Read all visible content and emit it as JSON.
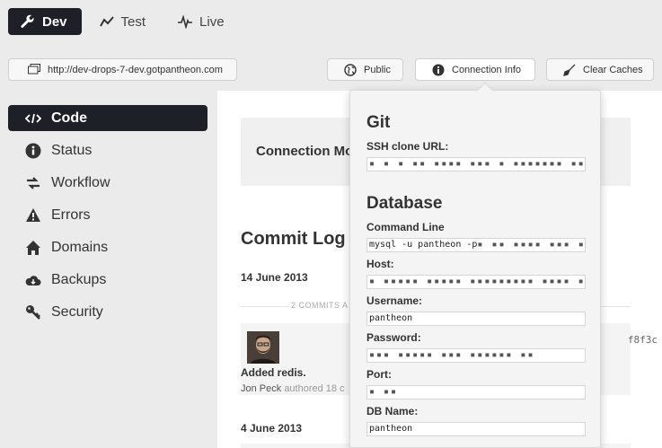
{
  "env_tabs": [
    {
      "label": "Dev",
      "icon": "wrench-icon",
      "active": true
    },
    {
      "label": "Test",
      "icon": "trend-icon",
      "active": false
    },
    {
      "label": "Live",
      "icon": "pulse-icon",
      "active": false
    }
  ],
  "url": "http://dev-drops-7-dev.gotpantheon.com",
  "toolbar": {
    "public_label": "Public",
    "conninfo_label": "Connection Info",
    "caches_label": "Clear Caches"
  },
  "sidebar": {
    "items": [
      {
        "label": "Code",
        "icon": "code-icon",
        "active": true
      },
      {
        "label": "Status",
        "icon": "info-icon",
        "active": false
      },
      {
        "label": "Workflow",
        "icon": "arrows-icon",
        "active": false
      },
      {
        "label": "Errors",
        "icon": "warning-icon",
        "active": false
      },
      {
        "label": "Domains",
        "icon": "home-icon",
        "active": false
      },
      {
        "label": "Backups",
        "icon": "cloud-icon",
        "active": false
      },
      {
        "label": "Security",
        "icon": "key-icon",
        "active": false
      }
    ]
  },
  "main": {
    "connection_mode_label": "Connection Mo",
    "commit_log_title": "Commit Log",
    "date1": "14 June 2013",
    "commits_count": "2 COMMITS A",
    "commit": {
      "message": "Added redis.",
      "author": "Jon Peck",
      "meta": "authored 18 c",
      "hash": "f8f3c"
    },
    "date2": "4 June 2013"
  },
  "popover": {
    "git_heading": "Git",
    "ssh_label": "SSH clone URL:",
    "ssh_value": "▪ ▪ ▪ ▪▪ ▪▪▪▪ ▪▪▪ ▪ ▪▪▪▪▪▪▪ ▪▪▪ ▪",
    "db_heading": "Database",
    "cmdline_label": "Command Line",
    "cmdline_value": "mysql -u pantheon -p",
    "cmdline_masked": "▪ ▪▪ ▪▪▪▪ ▪▪▪ ▪",
    "host_label": "Host:",
    "host_value": "▪ ▪▪▪▪▪ ▪▪▪▪▪ ▪▪▪▪▪▪▪▪▪ ▪▪▪▪ ▪",
    "username_label": "Username:",
    "username_value": "pantheon",
    "password_label": "Password:",
    "password_value": "▪▪▪ ▪▪▪▪▪ ▪▪▪ ▪▪▪▪▪▪ ▪▪",
    "port_label": "Port:",
    "port_value": "▪ ▪▪",
    "dbname_label": "DB Name:",
    "dbname_value": "pantheon"
  }
}
